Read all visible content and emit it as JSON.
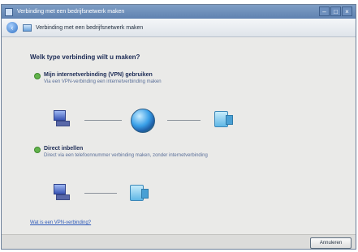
{
  "window": {
    "title": "Verbinding met een bedrijfsnetwerk maken",
    "controls": [
      "–",
      "□",
      "×"
    ]
  },
  "navbar": {
    "back_icon": "back-arrow-icon",
    "title": "Verbinding met een bedrijfsnetwerk maken"
  },
  "main": {
    "question": "Welk type verbinding wilt u maken?",
    "options": [
      {
        "title": "Mijn internetverbinding (VPN) gebruiken",
        "description": "Via een VPN-verbinding een internetverbinding maken",
        "diagram": [
          "computer-icon",
          "globe-icon",
          "network-icon"
        ]
      },
      {
        "title": "Direct inbellen",
        "description": "Direct via een telefoonnummer verbinding maken, zonder internetverbinding",
        "diagram": [
          "computer-icon",
          "network-icon"
        ]
      }
    ],
    "link": "Wat is een VPN-verbinding?"
  },
  "footer": {
    "cancel_label": "Annuleren"
  },
  "colors": {
    "title_bar": "#6f90bd",
    "accent_radio": "#62b34b",
    "heading_text": "#1c2b55",
    "link": "#2b57b8"
  }
}
